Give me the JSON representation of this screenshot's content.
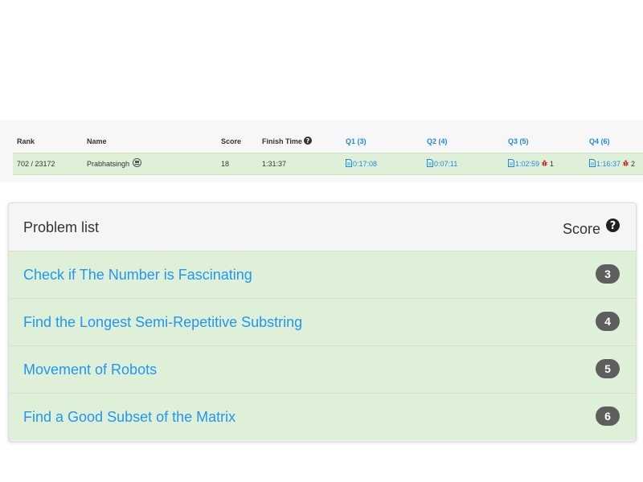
{
  "ranking": {
    "headers": {
      "rank": "Rank",
      "name": "Name",
      "score": "Score",
      "finish_time": "Finish Time",
      "q1": "Q1 (3)",
      "q2": "Q2 (4)",
      "q3": "Q3 (5)",
      "q4": "Q4 (6)"
    },
    "row": {
      "rank": "702 / 23172",
      "name": "Prabhatsingh",
      "score": "18",
      "finish_time": "1:31:37",
      "q1": {
        "time": "0:17:08"
      },
      "q2": {
        "time": "0:07:11"
      },
      "q3": {
        "time": "1:02:59",
        "wrong": "1"
      },
      "q4": {
        "time": "1:16:37",
        "wrong": "2"
      }
    }
  },
  "problem_list": {
    "title": "Problem list",
    "score_label": "Score",
    "items": [
      {
        "title": "Check if The Number is Fascinating",
        "score": "3"
      },
      {
        "title": "Find the Longest Semi-Repetitive Substring",
        "score": "4"
      },
      {
        "title": "Movement of Robots",
        "score": "5"
      },
      {
        "title": "Find a Good Subset of the Matrix",
        "score": "6"
      }
    ]
  },
  "colors": {
    "accent_link": "#2196f3",
    "accepted_row": "#dff0d8",
    "badge": "#5e5e5e",
    "bug": "#c62828"
  }
}
